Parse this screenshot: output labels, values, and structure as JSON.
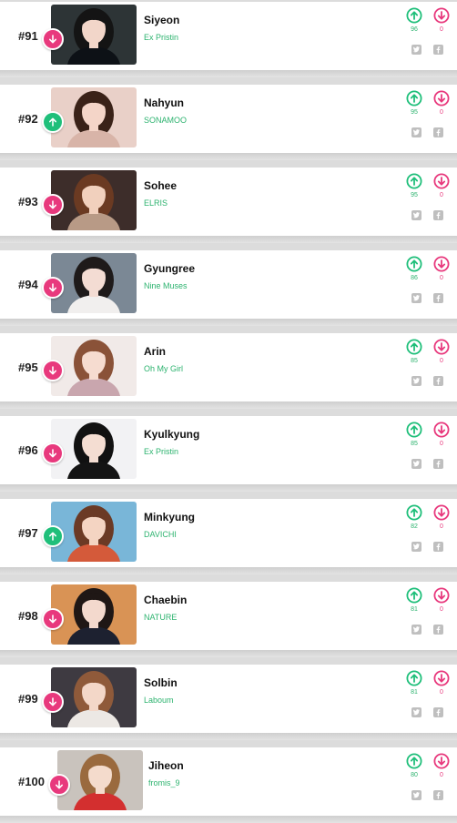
{
  "accent": {
    "up": "#1fbf7a",
    "down": "#e8397d",
    "group_text": "#2db36f"
  },
  "icons": {
    "trend_up": "arrow-up",
    "trend_down": "arrow-down",
    "share_twitter": "twitter-bird",
    "share_facebook": "facebook-f"
  },
  "entries": [
    {
      "rank": "#91",
      "name": "Siyeon",
      "group": "Ex Pristin",
      "trend": "down",
      "upvotes": "96",
      "downvotes": "0",
      "photo": {
        "bg": "#2d3436",
        "hair": "#141414",
        "skin": "#f2d6c9",
        "cloth": "#0d1116"
      }
    },
    {
      "rank": "#92",
      "name": "Nahyun",
      "group": "SONAMOO",
      "trend": "up",
      "upvotes": "95",
      "downvotes": "0",
      "photo": {
        "bg": "#e9d0c8",
        "hair": "#3a2218",
        "skin": "#f4d5c8",
        "cloth": "#d8b4a8"
      }
    },
    {
      "rank": "#93",
      "name": "Sohee",
      "group": "ELRIS",
      "trend": "down",
      "upvotes": "95",
      "downvotes": "0",
      "photo": {
        "bg": "#3d2d2a",
        "hair": "#6b3a22",
        "skin": "#f1d0bd",
        "cloth": "#b89a86"
      }
    },
    {
      "rank": "#94",
      "name": "Gyungree",
      "group": "Nine Muses",
      "trend": "down",
      "upvotes": "86",
      "downvotes": "0",
      "photo": {
        "bg": "#7b8895",
        "hair": "#1e1a1a",
        "skin": "#f3dcd3",
        "cloth": "#f1efee"
      }
    },
    {
      "rank": "#95",
      "name": "Arin",
      "group": "Oh My Girl",
      "trend": "down",
      "upvotes": "85",
      "downvotes": "0",
      "photo": {
        "bg": "#f1eae8",
        "hair": "#8a5238",
        "skin": "#f6dcd0",
        "cloth": "#c9a6ae"
      }
    },
    {
      "rank": "#96",
      "name": "Kyulkyung",
      "group": "Ex Pristin",
      "trend": "down",
      "upvotes": "85",
      "downvotes": "0",
      "photo": {
        "bg": "#f2f2f4",
        "hair": "#111111",
        "skin": "#f4ddd2",
        "cloth": "#141414"
      }
    },
    {
      "rank": "#97",
      "name": "Minkyung",
      "group": "DAVICHI",
      "trend": "up",
      "upvotes": "82",
      "downvotes": "0",
      "photo": {
        "bg": "#79b6d8",
        "hair": "#6b3a25",
        "skin": "#f4d4c2",
        "cloth": "#d45a3a"
      }
    },
    {
      "rank": "#98",
      "name": "Chaebin",
      "group": "NATURE",
      "trend": "down",
      "upvotes": "81",
      "downvotes": "0",
      "photo": {
        "bg": "#d99355",
        "hair": "#1f1715",
        "skin": "#f3d9cd",
        "cloth": "#1d2130"
      }
    },
    {
      "rank": "#99",
      "name": "Solbin",
      "group": "Laboum",
      "trend": "down",
      "upvotes": "81",
      "downvotes": "0",
      "photo": {
        "bg": "#3e3a41",
        "hair": "#8f5a3a",
        "skin": "#f3d7c8",
        "cloth": "#ece8e4"
      }
    },
    {
      "rank": "#100",
      "name": "Jiheon",
      "group": "fromis_9",
      "trend": "down",
      "upvotes": "80",
      "downvotes": "0",
      "photo": {
        "bg": "#c9c3bd",
        "hair": "#9a6a3e",
        "skin": "#f4dbcc",
        "cloth": "#d32f2f"
      }
    }
  ]
}
